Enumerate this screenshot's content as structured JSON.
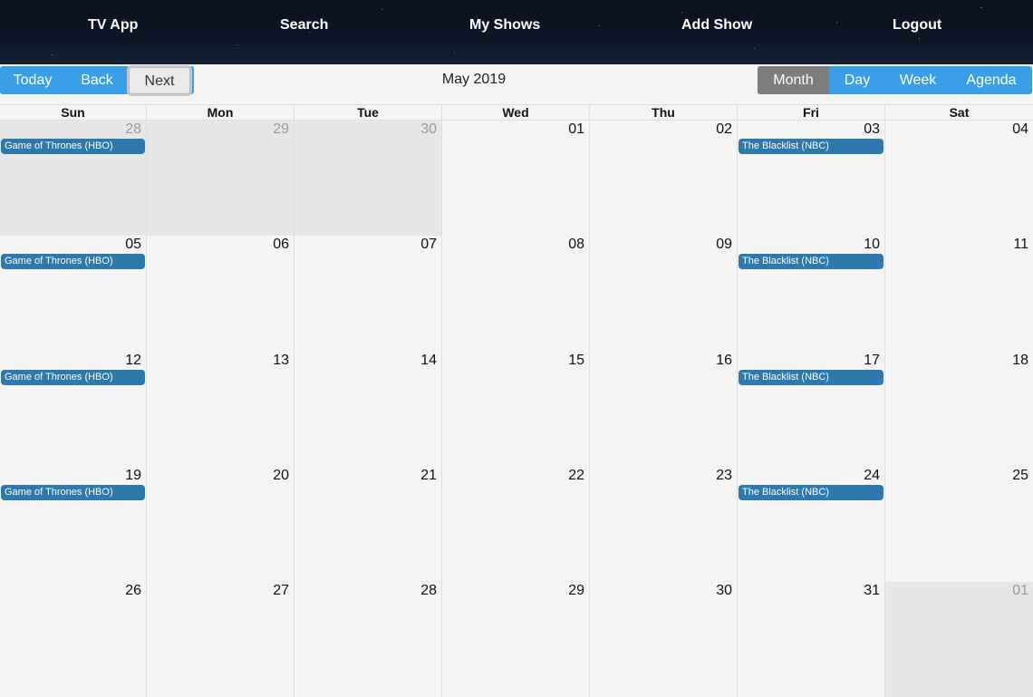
{
  "nav": {
    "items": [
      "TV App",
      "Search",
      "My Shows",
      "Add Show",
      "Logout"
    ]
  },
  "toolbar": {
    "today": "Today",
    "back": "Back",
    "next": "Next",
    "title": "May 2019",
    "views": [
      "Month",
      "Day",
      "Week",
      "Agenda"
    ],
    "active_view": "Month"
  },
  "calendar": {
    "weekdays": [
      "Sun",
      "Mon",
      "Tue",
      "Wed",
      "Thu",
      "Fri",
      "Sat"
    ],
    "weeks": [
      [
        "28",
        "29",
        "30",
        "01",
        "02",
        "03",
        "04"
      ],
      [
        "05",
        "06",
        "07",
        "08",
        "09",
        "10",
        "11"
      ],
      [
        "12",
        "13",
        "14",
        "15",
        "16",
        "17",
        "18"
      ],
      [
        "19",
        "20",
        "21",
        "22",
        "23",
        "24",
        "25"
      ],
      [
        "26",
        "27",
        "28",
        "29",
        "30",
        "31",
        "01"
      ]
    ],
    "events": {
      "got": "Game of Thrones (HBO)",
      "blacklist": "The Blacklist (NBC)"
    }
  },
  "colors": {
    "accent": "#3a9ee8",
    "event": "#2d79ad",
    "active_view": "#7d7d7d",
    "off_range": "#e6e6e6"
  }
}
